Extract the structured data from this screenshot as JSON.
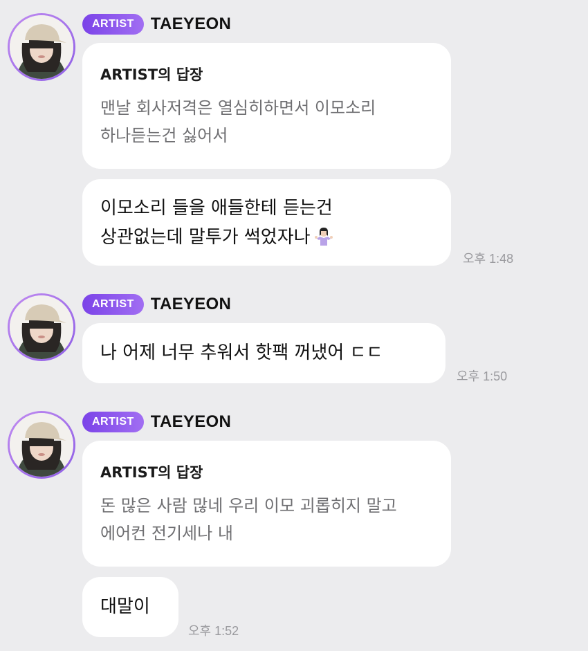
{
  "groups": [
    {
      "badge": "ARTIST",
      "name": "TAEYEON",
      "reply": {
        "title": "ARTIST의 답장",
        "lines": [
          "맨날 회사저격은 열심히하면서 이모소리",
          "하나듣는건 싫어서"
        ]
      },
      "message": {
        "lines": [
          "이모소리 들을 애들한테 듣는건",
          "상관없는데 말투가 썩었자나"
        ],
        "emoji": "person-shrugging-icon"
      },
      "time": "오후 1:48"
    },
    {
      "badge": "ARTIST",
      "name": "TAEYEON",
      "message": {
        "lines": [
          "나 어제 너무 추워서 핫팩 꺼냈어 ㄷㄷ"
        ]
      },
      "time": "오후 1:50"
    },
    {
      "badge": "ARTIST",
      "name": "TAEYEON",
      "reply": {
        "title": "ARTIST의 답장",
        "lines": [
          "돈 많은 사람 많네 우리 이모 괴롭히지 말고",
          "에어컨 전기세나 내"
        ]
      },
      "message": {
        "lines": [
          "대말이"
        ]
      },
      "time": "오후 1:52"
    }
  ],
  "colors": {
    "background": "#ececee",
    "bubble": "#ffffff",
    "badge_start": "#7b43e8",
    "badge_end": "#a16ef2",
    "reply_text": "#6f6f72",
    "time_text": "#9a9a9e"
  }
}
